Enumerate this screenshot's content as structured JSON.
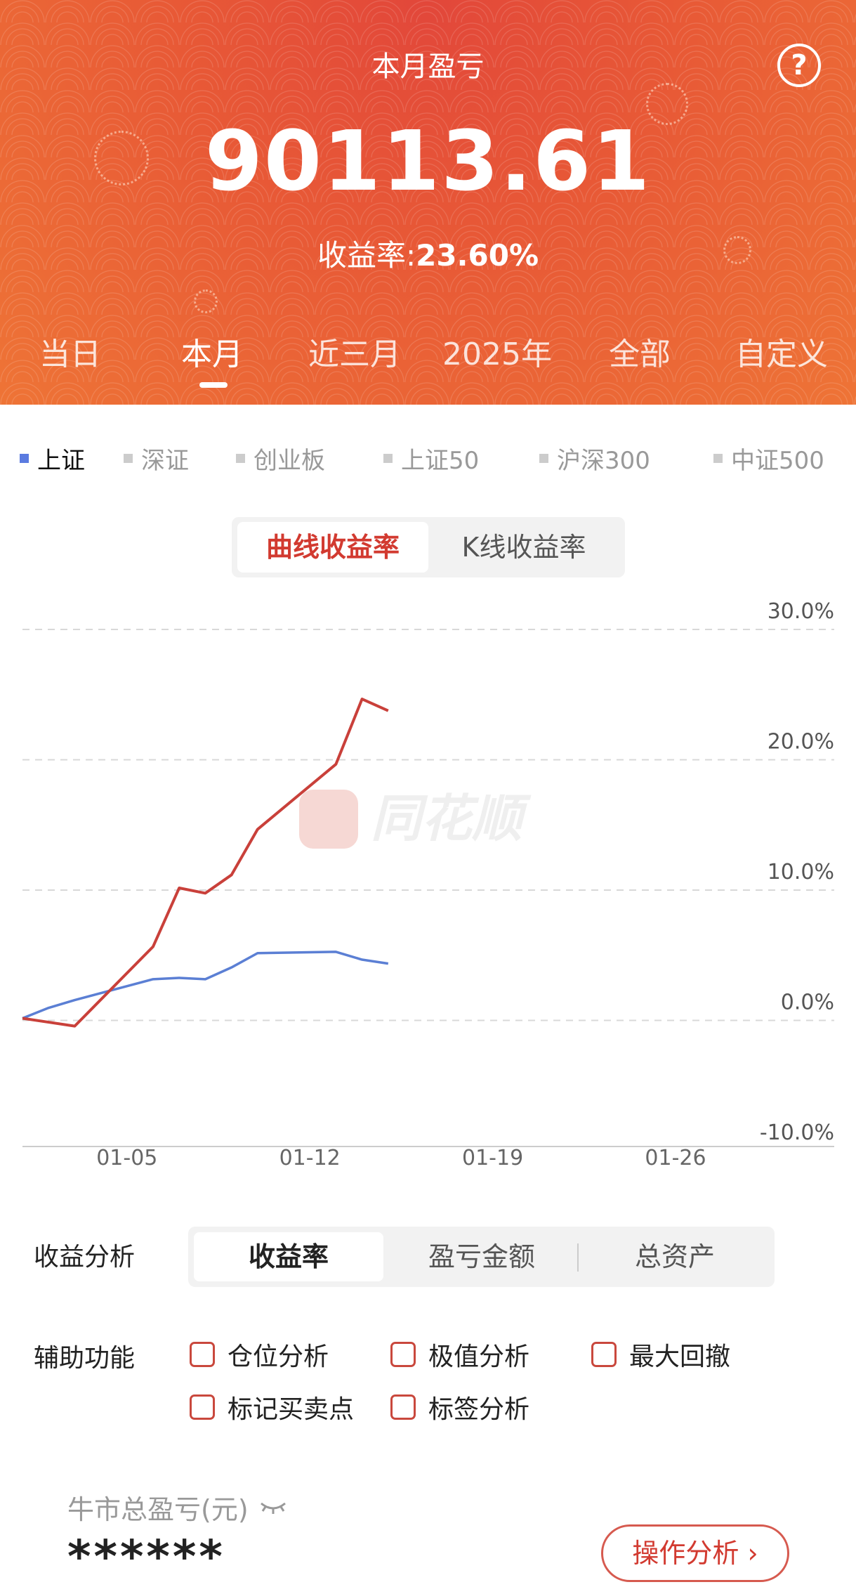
{
  "header": {
    "title": "本月盈亏",
    "help_icon": "question-circle-icon",
    "profit_amount": "90113.61",
    "rate_label": "收益率:",
    "rate_value": "23.60%",
    "period_tabs": [
      "当日",
      "本月",
      "近三月",
      "2025年",
      "全部",
      "自定义"
    ],
    "active_period": "本月"
  },
  "index_tabs": [
    "上证",
    "深证",
    "创业板",
    "上证50",
    "沪深300",
    "中证500"
  ],
  "active_index": "上证",
  "chart_mode": {
    "options": [
      "曲线收益率",
      "K线收益率"
    ],
    "active": "曲线收益率"
  },
  "watermark": "同花顺",
  "chart_data": {
    "type": "line",
    "x": [
      "01-01",
      "01-02",
      "01-03",
      "01-06",
      "01-07",
      "01-08",
      "01-09",
      "01-10",
      "01-13",
      "01-14",
      "01-15"
    ],
    "series": [
      {
        "color": "#c9403a",
        "values": [
          0.0,
          -0.3,
          -0.6,
          5.5,
          10.0,
          9.6,
          11.0,
          14.5,
          19.5,
          24.5,
          23.6
        ]
      },
      {
        "color": "#5b7fd4",
        "values": [
          0.0,
          0.8,
          1.4,
          3.0,
          3.1,
          3.0,
          3.9,
          5.0,
          5.1,
          4.5,
          4.2
        ]
      }
    ],
    "ylim": [
      -10,
      30
    ],
    "yticks": [
      "30.0%",
      "20.0%",
      "10.0%",
      "0.0%",
      "-10.0%"
    ],
    "xticks": [
      "01-05",
      "01-12",
      "01-19",
      "01-26"
    ],
    "grid": true
  },
  "analysis": {
    "label": "收益分析",
    "options": [
      "收益率",
      "盈亏金额",
      "总资产"
    ],
    "active": "收益率"
  },
  "aux": {
    "label": "辅助功能",
    "options": [
      "仓位分析",
      "极值分析",
      "最大回撤",
      "标记买卖点",
      "标签分析"
    ]
  },
  "bull": {
    "label": "牛市总盈亏(元)",
    "eye_icon": "eye-closed-icon",
    "value": "******",
    "button": "操作分析 ›"
  }
}
